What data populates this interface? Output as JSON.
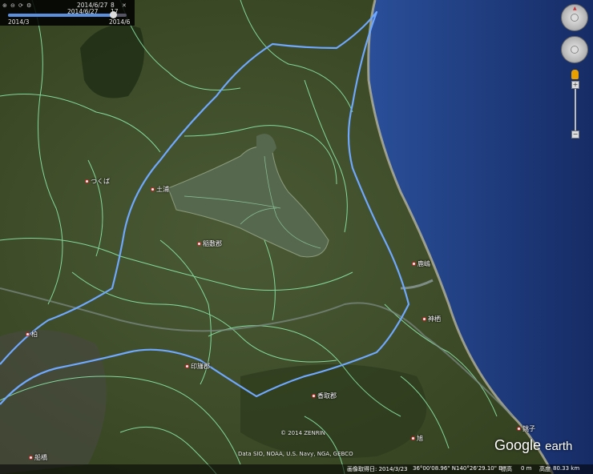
{
  "timebar": {
    "begin_date": "2014/6/27",
    "begin_num": "8",
    "end_date": "2014/6/27",
    "end_num": "17",
    "range_start": "2014/3",
    "range_end": "2014/6"
  },
  "places": [
    {
      "id": "tsukuba",
      "label": "つくば"
    },
    {
      "id": "tsuchiura",
      "label": "土浦"
    },
    {
      "id": "inashiki",
      "label": "稲敷郡"
    },
    {
      "id": "kashima",
      "label": "鹿嶋"
    },
    {
      "id": "kamisu",
      "label": "神栖"
    },
    {
      "id": "kashiwa",
      "label": "柏"
    },
    {
      "id": "inba",
      "label": "印旛郡"
    },
    {
      "id": "katori",
      "label": "香取郡"
    },
    {
      "id": "choshi",
      "label": "銚子"
    },
    {
      "id": "asahi",
      "label": "旭"
    },
    {
      "id": "funabashi",
      "label": "船橋"
    }
  ],
  "copyright": "© 2014 ZENRIN",
  "data_source": "Data SIO, NOAA, U.S. Navy, NGA, GEBCO",
  "logo": {
    "google": "Google",
    "earth": "earth"
  },
  "status": {
    "imagery_date_label": "画像取得日: 2014/3/23",
    "latitude": "36°00'08.96\" N",
    "longitude": "140°26'29.10\" E",
    "elevation_label": "標高",
    "elevation": "0 m",
    "altitude_label": "高度",
    "altitude": "80.33 km"
  },
  "colors": {
    "route": "#6fa8ff",
    "boundary": "#8ef0b0",
    "ocean": "#1f3f86",
    "land": "#3b4a2a",
    "lake": "#5a6e55"
  },
  "icons": [
    "zoom-in-icon",
    "zoom-out-icon",
    "refresh-icon",
    "settings-icon",
    "wrench-icon",
    "compass-icon",
    "look-joystick-icon",
    "move-joystick-icon",
    "pegman-icon"
  ]
}
